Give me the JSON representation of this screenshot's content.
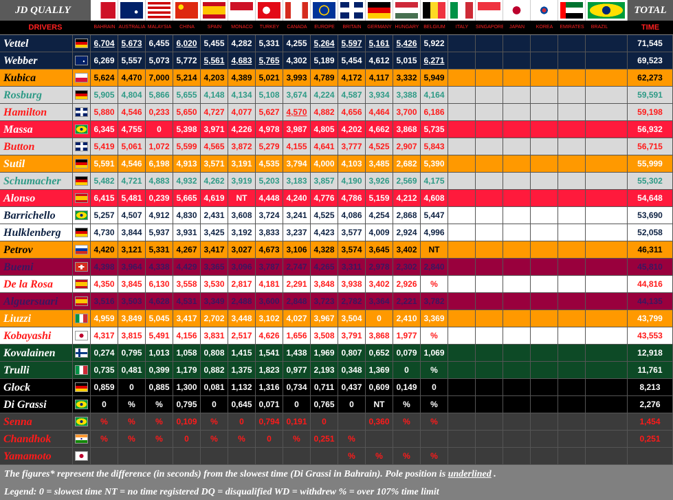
{
  "header": {
    "title": "JD QUALLY",
    "total_title": "TOTAL",
    "drivers_label": "DRIVERS",
    "time_label": "TIME"
  },
  "races": [
    {
      "name": "BAHRAIN",
      "flag": "bahrain-flag"
    },
    {
      "name": "AUSTRALIA",
      "flag": "australia-flag"
    },
    {
      "name": "MALAYSIA",
      "flag": "malaysia-flag"
    },
    {
      "name": "CHINA",
      "flag": "china-flag"
    },
    {
      "name": "SPAIN",
      "flag": "spain-flag"
    },
    {
      "name": "MONACO",
      "flag": "monaco-flag"
    },
    {
      "name": "TURKEY",
      "flag": "turkey-flag"
    },
    {
      "name": "CANADA",
      "flag": "canada-flag"
    },
    {
      "name": "EUROPE",
      "flag": "eu-flag"
    },
    {
      "name": "BRITAIN",
      "flag": "uk-flag"
    },
    {
      "name": "GERMANY",
      "flag": "germany-flag"
    },
    {
      "name": "HUNGARY",
      "flag": "hungary-flag"
    },
    {
      "name": "BELGIUM",
      "flag": "belgium-flag"
    },
    {
      "name": "ITALY",
      "flag": "italy-flag"
    },
    {
      "name": "SINGAPORE",
      "flag": "singapore-flag"
    },
    {
      "name": "JAPAN",
      "flag": "japan-flag"
    },
    {
      "name": "KOREA",
      "flag": "korea-flag"
    },
    {
      "name": "EMIRATES",
      "flag": "uae-flag"
    },
    {
      "name": "BRAZIL",
      "flag": "brazil-flag"
    }
  ],
  "colors": {
    "navy": "#0d2142",
    "orange": "#ff9900",
    "silver": "#d9d9d9",
    "red": "#ff1a3c",
    "white": "#ffffff",
    "maroon": "#99003d",
    "green": "#0d4a26",
    "black": "#000000",
    "dark": "#3b3b3b",
    "text_red": "#ff1a1a",
    "text_teal": "#2e9a86",
    "text_navy": "#0d2142",
    "text_purple": "#3a1760"
  },
  "drivers": [
    {
      "name": "Vettel",
      "flag": "germany-flag",
      "bg": "navy",
      "fg": "#ffffff",
      "times": [
        "6,704",
        "5,673",
        "6,455",
        "6,020",
        "5,455",
        "4,282",
        "5,331",
        "4,255",
        "5,264",
        "5,597",
        "5,161",
        "5,426",
        "5,922"
      ],
      "under": [
        0,
        1,
        3,
        8,
        9,
        10,
        11
      ],
      "total": "71,545"
    },
    {
      "name": "Webber",
      "flag": "australia-flag",
      "bg": "navy",
      "fg": "#ffffff",
      "times": [
        "6,269",
        "5,557",
        "5,073",
        "5,772",
        "5,561",
        "4,683",
        "5,765",
        "4,302",
        "5,189",
        "5,454",
        "4,612",
        "5,015",
        "6,271"
      ],
      "under": [
        4,
        5,
        6,
        12
      ],
      "total": "69,523"
    },
    {
      "name": "Kubica",
      "flag": "poland-flag",
      "bg": "orange",
      "fg": "#000000",
      "times": [
        "5,624",
        "4,470",
        "7,000",
        "5,214",
        "4,203",
        "4,389",
        "5,021",
        "3,993",
        "4,789",
        "4,172",
        "4,117",
        "3,332",
        "5,949"
      ],
      "under": [],
      "total": "62,273"
    },
    {
      "name": "Rosburg",
      "flag": "germany-flag",
      "bg": "silver",
      "fg": "#2e9a86",
      "times": [
        "5,905",
        "4,804",
        "5,866",
        "5,655",
        "4,148",
        "4,134",
        "5,108",
        "3,674",
        "4,224",
        "4,587",
        "3,934",
        "3,388",
        "4,164"
      ],
      "under": [],
      "total": "59,591"
    },
    {
      "name": "Hamilton",
      "flag": "uk-flag",
      "bg": "silver",
      "fg": "#ff1a1a",
      "times": [
        "5,880",
        "4,546",
        "0,233",
        "5,650",
        "4,727",
        "4,077",
        "5,627",
        "4,570",
        "4,882",
        "4,656",
        "4,464",
        "3,700",
        "6,186"
      ],
      "under": [
        7
      ],
      "total": "59,198"
    },
    {
      "name": "Massa",
      "flag": "brazil-flag",
      "bg": "red",
      "fg": "#ffffff",
      "times": [
        "6,345",
        "4,755",
        "0",
        "5,398",
        "3,971",
        "4,226",
        "4,978",
        "3,987",
        "4,805",
        "4,202",
        "4,662",
        "3,868",
        "5,735"
      ],
      "under": [],
      "total": "56,932"
    },
    {
      "name": "Button",
      "flag": "uk-flag",
      "bg": "silver",
      "fg": "#ff1a1a",
      "times": [
        "5,419",
        "5,061",
        "1,072",
        "5,599",
        "4,565",
        "3,872",
        "5,279",
        "4,155",
        "4,641",
        "3,777",
        "4,525",
        "2,907",
        "5,843"
      ],
      "under": [],
      "total": "56,715"
    },
    {
      "name": "Sutil",
      "flag": "germany-flag",
      "bg": "orange",
      "fg": "#ffffff",
      "times": [
        "5,591",
        "4,546",
        "6,198",
        "4,913",
        "3,571",
        "3,191",
        "4,535",
        "3,794",
        "4,000",
        "4,103",
        "3,485",
        "2,682",
        "5,390"
      ],
      "under": [],
      "total": "55,999"
    },
    {
      "name": "Schumacher",
      "flag": "germany-flag",
      "bg": "silver",
      "fg": "#2e9a86",
      "times": [
        "5,482",
        "4,721",
        "4,883",
        "4,932",
        "4,262",
        "3,919",
        "5,203",
        "3,183",
        "3,857",
        "4,190",
        "3,926",
        "2,569",
        "4,175"
      ],
      "under": [],
      "total": "55,302"
    },
    {
      "name": "Alonso",
      "flag": "spain-flag",
      "bg": "red",
      "fg": "#ffffff",
      "times": [
        "6,415",
        "5,481",
        "0,239",
        "5,665",
        "4,619",
        "NT",
        "4,448",
        "4,240",
        "4,776",
        "4,786",
        "5,159",
        "4,212",
        "4,608"
      ],
      "under": [],
      "total": "54,648"
    },
    {
      "name": "Barrichello",
      "flag": "brazil-flag",
      "bg": "white",
      "fg": "#0d2142",
      "times": [
        "5,257",
        "4,507",
        "4,912",
        "4,830",
        "2,431",
        "3,608",
        "3,724",
        "3,241",
        "4,525",
        "4,086",
        "4,254",
        "2,868",
        "5,447"
      ],
      "under": [],
      "total": "53,690"
    },
    {
      "name": "Hulklenberg",
      "flag": "germany-flag",
      "bg": "white",
      "fg": "#0d2142",
      "times": [
        "4,730",
        "3,844",
        "5,937",
        "3,931",
        "3,425",
        "3,192",
        "3,833",
        "3,237",
        "4,423",
        "3,577",
        "4,009",
        "2,924",
        "4,996"
      ],
      "under": [],
      "total": "52,058"
    },
    {
      "name": "Petrov",
      "flag": "russia-flag",
      "bg": "orange",
      "fg": "#000000",
      "times": [
        "4,420",
        "3,121",
        "5,331",
        "4,267",
        "3,417",
        "3,027",
        "4,673",
        "3,106",
        "4,328",
        "3,574",
        "3,645",
        "3,402",
        "NT"
      ],
      "under": [],
      "total": "46,311"
    },
    {
      "name": "Buemi",
      "flag": "switzerland-flag",
      "bg": "maroon",
      "fg": "#3a1760",
      "times": [
        "4,398",
        "3,964",
        "4,338",
        "4,429",
        "3,365",
        "3,096",
        "3,787",
        "2,747",
        "4,265",
        "3,311",
        "2,978",
        "2,302",
        "2,840"
      ],
      "under": [],
      "total": "45,810"
    },
    {
      "name": "De la Rosa",
      "flag": "spain-flag",
      "bg": "white",
      "fg": "#ff1a1a",
      "times": [
        "4,350",
        "3,845",
        "6,130",
        "3,558",
        "3,530",
        "2,817",
        "4,181",
        "2,291",
        "3,848",
        "3,938",
        "3,402",
        "2,926",
        "%"
      ],
      "under": [],
      "total": "44,816"
    },
    {
      "name": "Alguersuari",
      "flag": "spain-flag",
      "bg": "maroon",
      "fg": "#3a1760",
      "times": [
        "3,516",
        "3,503",
        "4,628",
        "4,531",
        "3,349",
        "2,488",
        "3,600",
        "2,848",
        "3,723",
        "2,782",
        "3,364",
        "2,221",
        "3,782"
      ],
      "under": [],
      "total": "44,135"
    },
    {
      "name": "Liuzzi",
      "flag": "italy-flag",
      "bg": "orange",
      "fg": "#ffffff",
      "times": [
        "4,959",
        "3,849",
        "5,045",
        "3,417",
        "2,702",
        "3,448",
        "3,102",
        "4,027",
        "3,967",
        "3,504",
        "0",
        "2,410",
        "3,369"
      ],
      "under": [],
      "total": "43,799"
    },
    {
      "name": "Kobayashi",
      "flag": "japan-flag",
      "bg": "white",
      "fg": "#ff1a1a",
      "times": [
        "4,317",
        "3,815",
        "5,491",
        "4,156",
        "3,831",
        "2,517",
        "4,626",
        "1,656",
        "3,508",
        "3,791",
        "3,868",
        "1,977",
        "%"
      ],
      "under": [],
      "total": "43,553"
    },
    {
      "name": "Kovalainen",
      "flag": "finland-flag",
      "bg": "green",
      "fg": "#ffffff",
      "times": [
        "0,274",
        "0,795",
        "1,013",
        "1,058",
        "0,808",
        "1,415",
        "1,541",
        "1,438",
        "1,969",
        "0,807",
        "0,652",
        "0,079",
        "1,069"
      ],
      "under": [],
      "total": "12,918"
    },
    {
      "name": "Trulli",
      "flag": "italy-flag",
      "bg": "green",
      "fg": "#ffffff",
      "times": [
        "0,735",
        "0,481",
        "0,399",
        "1,179",
        "0,882",
        "1,375",
        "1,823",
        "0,977",
        "2,193",
        "0,348",
        "1,369",
        "0",
        "%"
      ],
      "under": [],
      "total": "11,761"
    },
    {
      "name": "Glock",
      "flag": "germany-flag",
      "bg": "black",
      "fg": "#ffffff",
      "times": [
        "0,859",
        "0",
        "0,885",
        "1,300",
        "0,081",
        "1,132",
        "1,316",
        "0,734",
        "0,711",
        "0,437",
        "0,609",
        "0,149",
        "0"
      ],
      "under": [],
      "total": "8,213"
    },
    {
      "name": "Di Grassi",
      "flag": "brazil-flag",
      "bg": "black",
      "fg": "#ffffff",
      "times": [
        "0",
        "%",
        "%",
        "0,795",
        "0",
        "0,645",
        "0,071",
        "0",
        "0,765",
        "0",
        "NT",
        "%",
        "%"
      ],
      "under": [],
      "total": "2,276"
    },
    {
      "name": "Senna",
      "flag": "brazil-flag",
      "bg": "dark",
      "fg": "#ff1a1a",
      "times": [
        "%",
        "%",
        "%",
        "0,109",
        "%",
        "0",
        "0,794",
        "0,191",
        "0",
        "",
        "0,360",
        "%",
        "%"
      ],
      "under": [],
      "total": "1,454"
    },
    {
      "name": "Chandhok",
      "flag": "india-flag",
      "bg": "dark",
      "fg": "#ff1a1a",
      "times": [
        "%",
        "%",
        "%",
        "0",
        "%",
        "%",
        "0",
        "%",
        "0,251",
        "%",
        "",
        "",
        ""
      ],
      "under": [],
      "total": "0,251"
    },
    {
      "name": "Yamamoto",
      "flag": "japan-flag",
      "bg": "dark",
      "fg": "#ff1a1a",
      "times": [
        "",
        "",
        "",
        "",
        "",
        "",
        "",
        "",
        "",
        "%",
        "%",
        "%",
        "%"
      ],
      "under": [],
      "total": ""
    }
  ],
  "footer": {
    "line1_pre": "The figures* represent the difference (in seconds) from the slowest time (Di Grassi in Bahrain). Pole position is ",
    "line1_underlined": "underlined",
    "line1_post": " .",
    "legend": "Legend:   0 = slowest time    NT = no time registered    DQ = disqualified    WD = withdrew    % = over 107% time limit"
  }
}
